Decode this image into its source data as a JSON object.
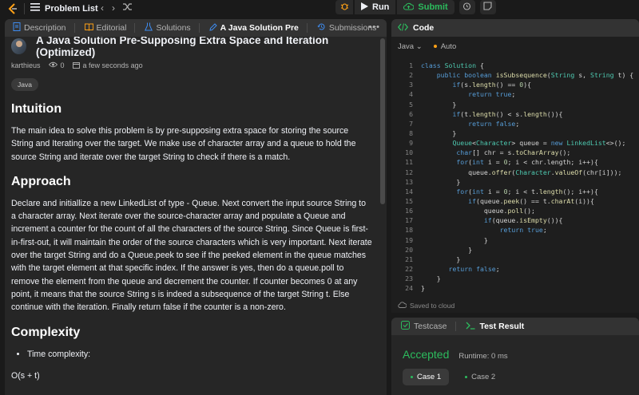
{
  "topbar": {
    "problem_list_label": "Problem List",
    "run_label": "Run",
    "submit_label": "Submit"
  },
  "left_tabs": [
    {
      "label": "Description",
      "icon": "document-icon"
    },
    {
      "label": "Editorial",
      "icon": "book-icon"
    },
    {
      "label": "Solutions",
      "icon": "flask-icon"
    },
    {
      "label": "A Java Solution Pre",
      "icon": "pencil-icon",
      "active": true
    },
    {
      "label": "Submissions",
      "icon": "history-icon"
    }
  ],
  "post": {
    "title": "A Java Solution Pre-Supposing Extra Space and Iteration (Optimized)",
    "author": "karthieus",
    "views": "0",
    "time": "a few seconds ago",
    "tag": "Java",
    "sections": {
      "intuition_heading": "Intuition",
      "intuition_text": "The main idea to solve this problem is by pre-supposing extra space for storing the source String and Iterating over the target. We make use of character array and a queue to hold the source String and iterate over the target String to check if there is a match.",
      "approach_heading": "Approach",
      "approach_text": "Declare and initiallize a new LinkedList of type - Queue. Next convert the input source String to a character array. Next iterate over the source-character array and populate a Queue and increment a counter for the count of all the characters of the source String. Since Queue is first-in-first-out, it will maintain the order of the source characters which is very important. Next iterate over the target String and do a Queue.peek to see if the peeked element in the queue matches with the target element at that specific index. If the answer is yes, then do a queue.poll to remove the element from the queue and decrement the counter. If counter becomes 0 at any point, it means that the source String s is indeed a subsequence of the target String t. Else continue with the iteration. Finally return false if the counter is a non-zero.",
      "complexity_heading": "Complexity",
      "time_complexity_label": "Time complexity:",
      "time_complexity_value": "O(s + t)"
    }
  },
  "code_panel": {
    "title": "Code",
    "language": "Java",
    "mode": "Auto",
    "saved_status": "Saved to cloud"
  },
  "bottom_panel": {
    "testcase_tab": "Testcase",
    "result_tab": "Test Result",
    "verdict": "Accepted",
    "runtime": "Runtime: 0 ms",
    "cases": [
      "Case 1",
      "Case 2"
    ]
  },
  "colors": {
    "accent_green": "#2cbb5d",
    "accent_orange": "#ffa116",
    "accent_blue": "#3e8cf0"
  }
}
